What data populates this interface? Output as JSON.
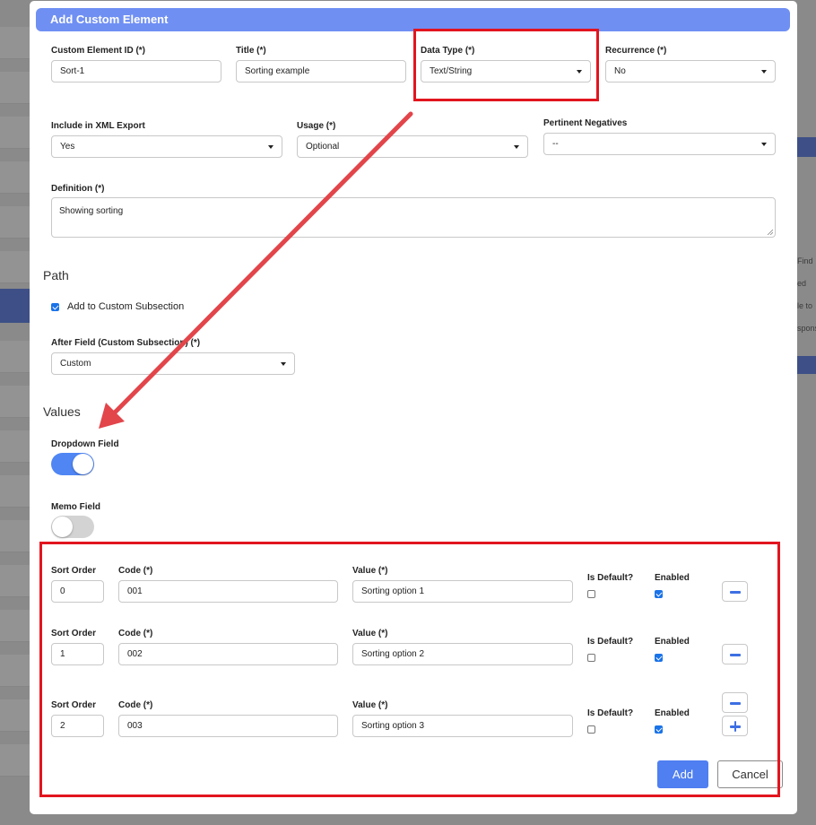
{
  "modal": {
    "title": "Add Custom Element"
  },
  "fields": {
    "custom_element_id": {
      "label": "Custom Element ID (*)",
      "value": "Sort-1"
    },
    "title": {
      "label": "Title (*)",
      "value": "Sorting example"
    },
    "data_type": {
      "label": "Data Type (*)",
      "value": "Text/String"
    },
    "recurrence": {
      "label": "Recurrence (*)",
      "value": "No"
    },
    "include_xml": {
      "label": "Include in XML Export",
      "value": "Yes"
    },
    "usage": {
      "label": "Usage (*)",
      "value": "Optional"
    },
    "pertinent_negatives": {
      "label": "Pertinent Negatives",
      "value": "--"
    },
    "definition": {
      "label": "Definition (*)",
      "value": "Showing sorting"
    }
  },
  "path": {
    "title": "Path",
    "add_to_subsection": {
      "label": "Add to Custom Subsection",
      "checked": true
    },
    "after_field": {
      "label": "After Field (Custom Subsection) (*)",
      "value": "Custom"
    }
  },
  "values_section": {
    "title": "Values",
    "dropdown_field": {
      "label": "Dropdown Field",
      "on": true
    },
    "memo_field": {
      "label": "Memo Field",
      "on": false
    }
  },
  "value_rows": {
    "labels": {
      "sort_order": "Sort Order",
      "code": "Code (*)",
      "value": "Value (*)",
      "is_default": "Is Default?",
      "enabled": "Enabled"
    },
    "rows": [
      {
        "sort_order": "0",
        "code": "001",
        "value": "Sorting option 1",
        "is_default": false,
        "enabled": true
      },
      {
        "sort_order": "1",
        "code": "002",
        "value": "Sorting option 2",
        "is_default": false,
        "enabled": true
      },
      {
        "sort_order": "2",
        "code": "003",
        "value": "Sorting option 3",
        "is_default": false,
        "enabled": true
      }
    ]
  },
  "actions": {
    "add_label": "Add",
    "cancel_label": "Cancel"
  },
  "background": {
    "right_fragments": [
      "Find",
      "ed",
      "le to",
      "spons"
    ]
  },
  "colors": {
    "header": "#6f8ff3",
    "primary": "#4f7ff1",
    "annotation": "#e2151f",
    "toggle_on": "#4f86f4"
  },
  "icons": {
    "remove": "minus-icon",
    "add": "plus-icon",
    "dropdown": "chevron-down-icon",
    "checkbox": "checkmark-icon"
  }
}
